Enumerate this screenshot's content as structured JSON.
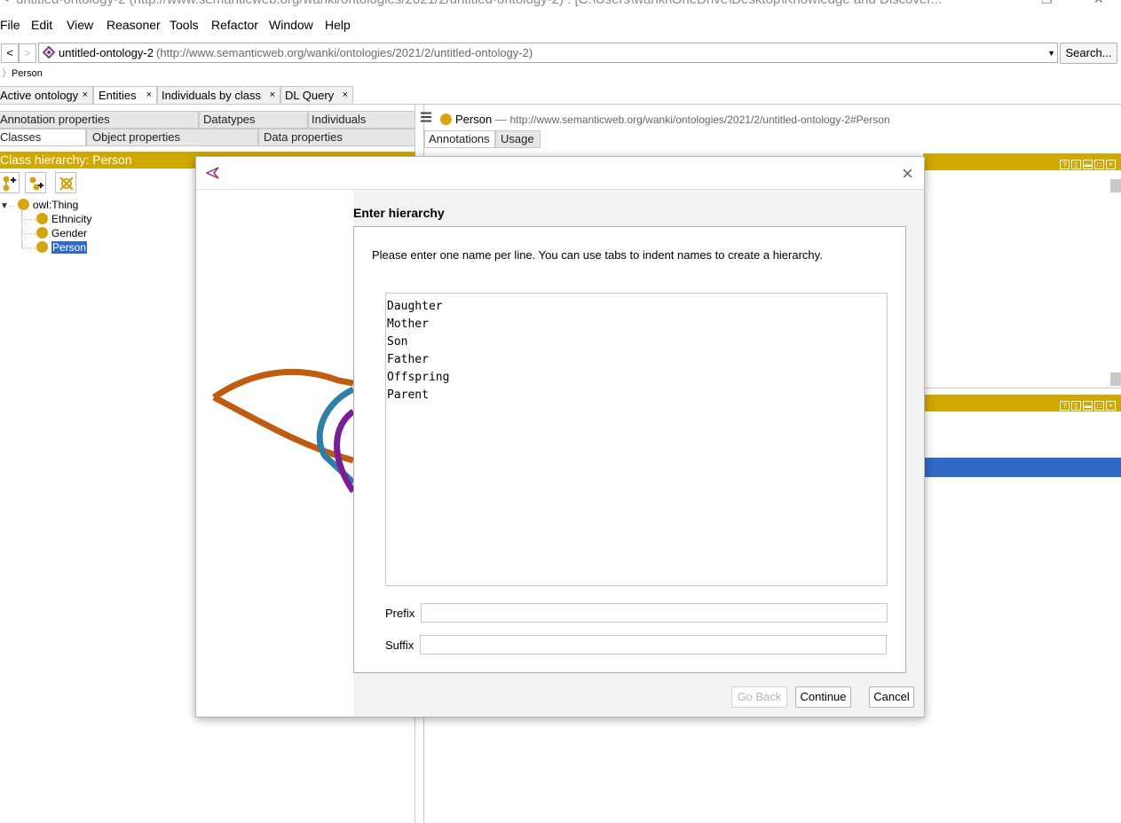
{
  "window": {
    "title": "untitled-ontology-2 (http://www.semanticweb.org/wanki/ontologies/2021/2/untitled-ontology-2) : [C:\\Users\\wanki\\OneDrive\\Desktop\\Knowledge and Discover..."
  },
  "menu": [
    "File",
    "Edit",
    "View",
    "Reasoner",
    "Tools",
    "Refactor",
    "Window",
    "Help"
  ],
  "nav": {
    "back": "<",
    "forward": ">",
    "ontology_name": "untitled-ontology-2",
    "ontology_iri": "(http://www.semanticweb.org/wanki/ontologies/2021/2/untitled-ontology-2)",
    "search_label": "Search...",
    "breadcrumb": "Person"
  },
  "workspace_tabs": [
    {
      "label": "Active ontology",
      "close": "×"
    },
    {
      "label": "Entities",
      "close": "×"
    },
    {
      "label": "Individuals by class",
      "close": "×"
    },
    {
      "label": "DL Query",
      "close": "×"
    }
  ],
  "entity_tabs": {
    "row1": [
      "Annotation properties",
      "Datatypes",
      "Individuals"
    ],
    "row2": [
      "Classes",
      "Object properties",
      "Data properties"
    ]
  },
  "class_hierarchy": {
    "title": "Class hierarchy: Person",
    "root": "owl:Thing",
    "children": [
      "Ethnicity",
      "Gender",
      "Person"
    ],
    "selected": "Person"
  },
  "entity_header": {
    "name": "Person",
    "dash": "—",
    "iri": "http://www.semanticweb.org/wanki/ontologies/2021/2/untitled-ontology-2#Person",
    "tabs": [
      "Annotations",
      "Usage"
    ]
  },
  "dialog": {
    "header": "Enter hierarchy",
    "prompt": "Please enter one name per line. You can use tabs to indent names to create a hierarchy.",
    "hierarchy_text": "Daughter\nMother\nSon\nFather\nOffspring\nParent",
    "prefix_label": "Prefix",
    "prefix_value": "",
    "suffix_label": "Suffix",
    "suffix_value": "",
    "go_back": "Go Back",
    "continue": "Continue",
    "cancel": "Cancel",
    "close": "×"
  },
  "colors": {
    "gold": "#d1a801",
    "selection": "#316ac5",
    "class_bullet": "#d4a50e"
  }
}
